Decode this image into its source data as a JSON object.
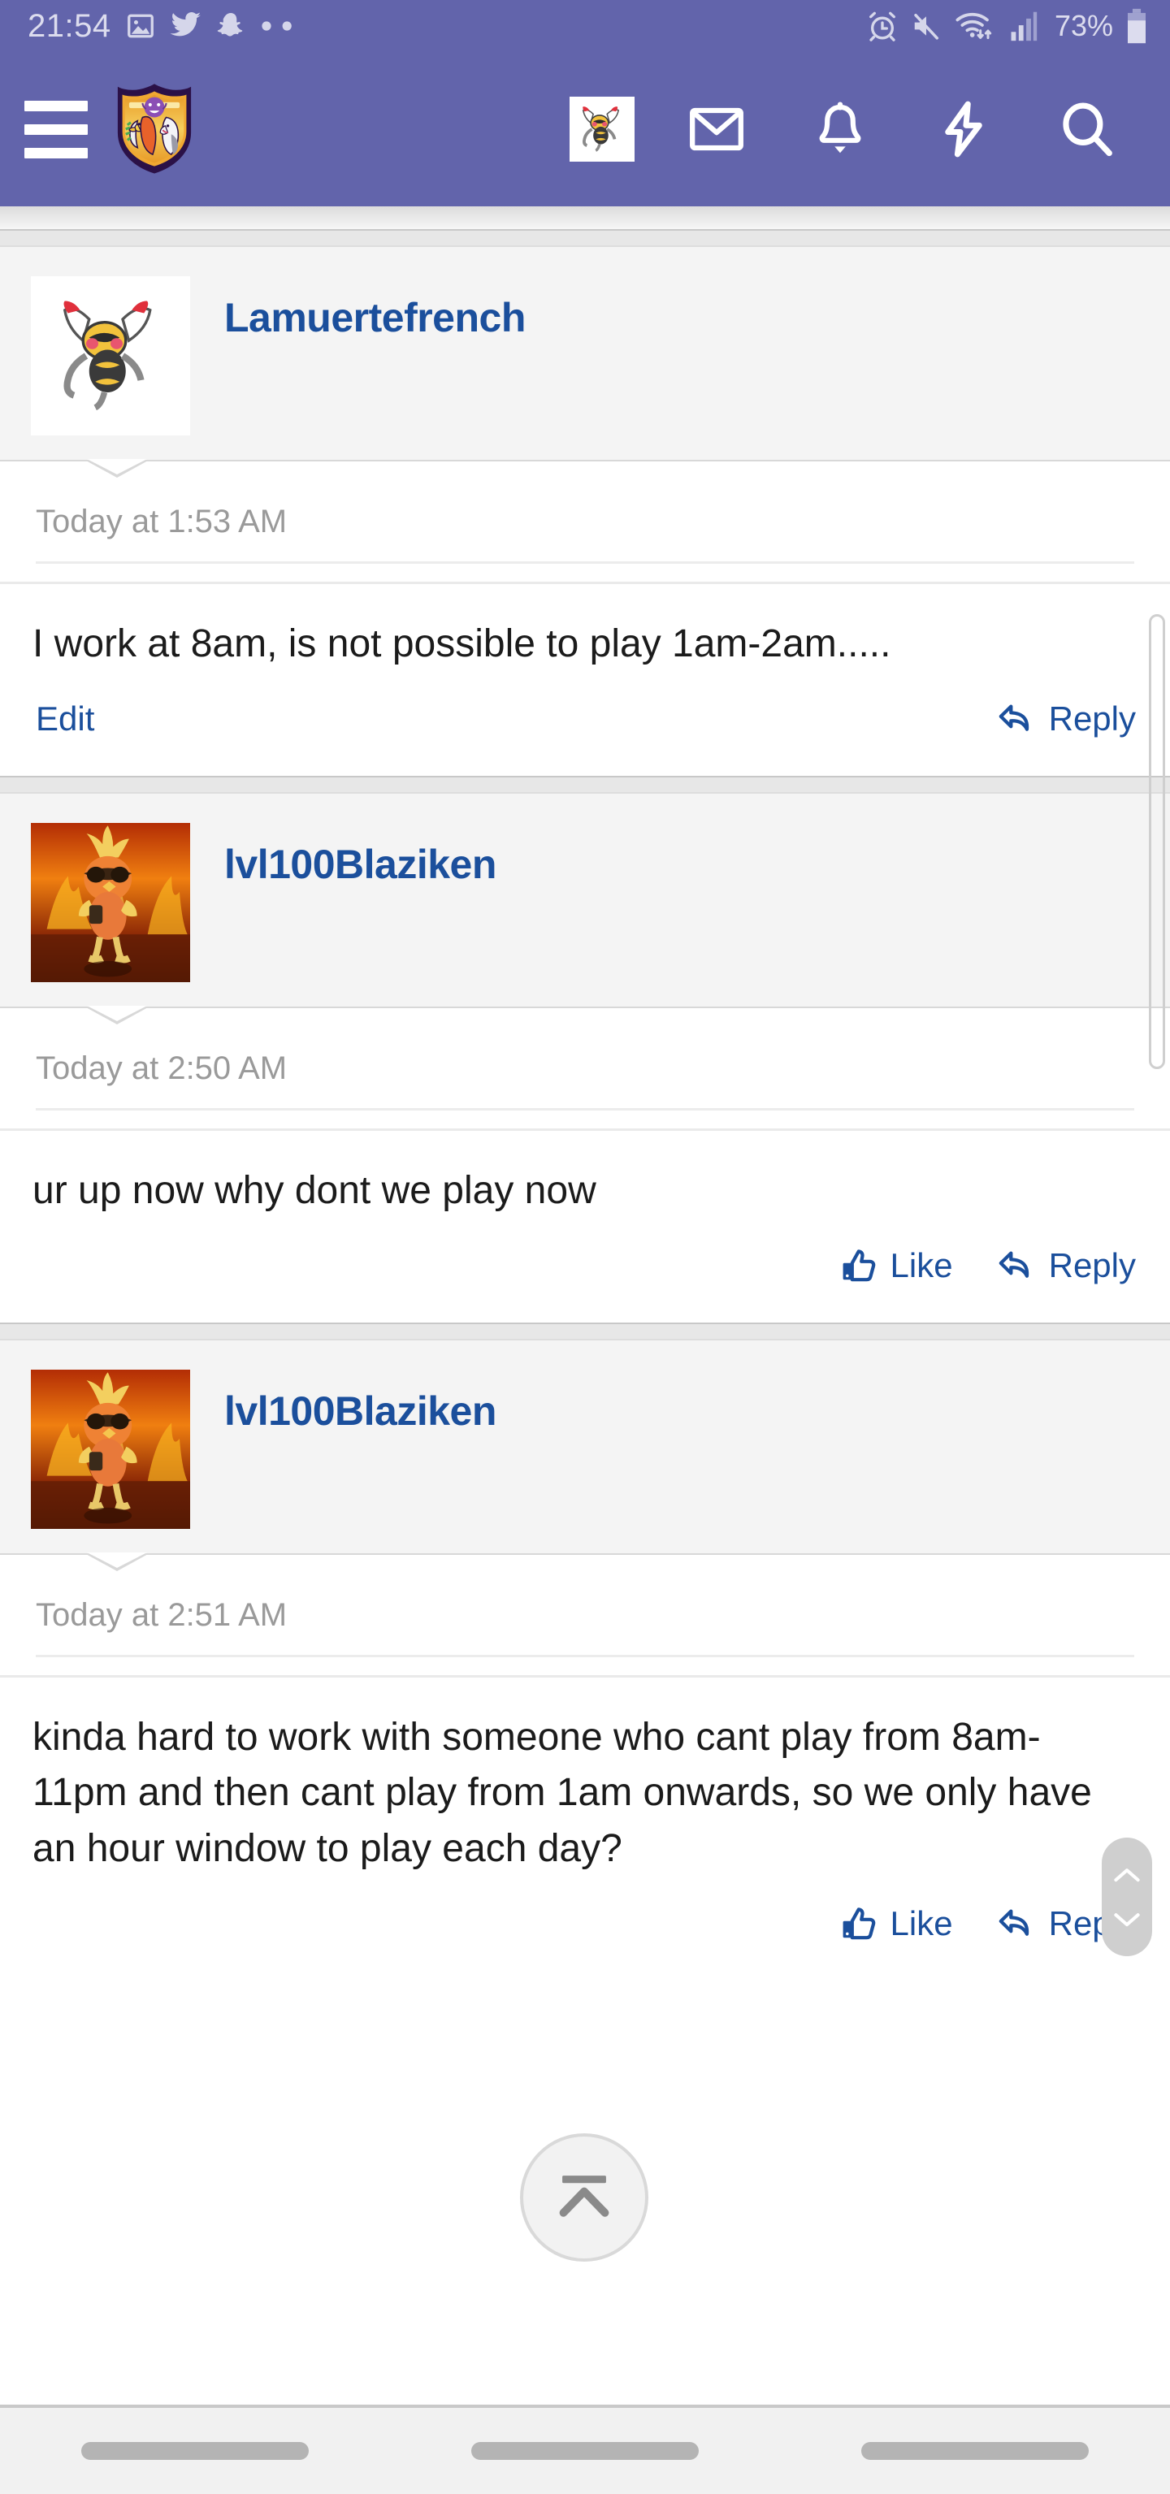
{
  "status_bar": {
    "time": "21:54",
    "battery_percent": "73%",
    "left_icons": [
      "photo-icon",
      "twitter-icon",
      "snapchat-icon",
      "more-dots-icon"
    ],
    "right_icons": [
      "alarm-icon",
      "mute-icon",
      "wifi-icon",
      "signal-icon",
      "battery-icon"
    ],
    "background": "#6264ab",
    "foreground": "#dcdcee"
  },
  "navbar": {
    "background": "#6264ab",
    "menu_icon": "hamburger-menu-icon",
    "logo": "forum-shield-logo",
    "items": [
      {
        "name": "account-avatar",
        "icon": "beedrill-avatar"
      },
      {
        "name": "inbox",
        "icon": "envelope-icon"
      },
      {
        "name": "alerts",
        "icon": "bell-icon"
      },
      {
        "name": "whats-new",
        "icon": "lightning-bolt-icon"
      },
      {
        "name": "search",
        "icon": "magnifier-icon"
      }
    ]
  },
  "thread": {
    "posts": [
      {
        "author": "Lamuertefrench",
        "avatar": "beedrill-sprite",
        "timestamp": "Today at 1:53 AM",
        "message": "I work at 8am, is not possible to play 1am-2am.....",
        "actions": [
          {
            "label": "Edit",
            "icon": null,
            "align": "left"
          },
          {
            "label": "Reply",
            "icon": "reply-arrow-icon",
            "align": "right"
          }
        ]
      },
      {
        "author": "lvl100Blaziken",
        "avatar": "torchic-fire-art",
        "timestamp": "Today at 2:50 AM",
        "message": "ur up now why dont we play now",
        "actions": [
          {
            "label": "Like",
            "icon": "thumbs-up-icon",
            "align": "right"
          },
          {
            "label": "Reply",
            "icon": "reply-arrow-icon",
            "align": "right"
          }
        ]
      },
      {
        "author": "lvl100Blaziken",
        "avatar": "torchic-fire-art",
        "timestamp": "Today at 2:51 AM",
        "message": "kinda hard to work with someone who cant play from 8am-11pm and then cant play from 1am onwards, so we only have an hour window to play each day?",
        "actions": [
          {
            "label": "Like",
            "icon": "thumbs-up-icon",
            "align": "right"
          },
          {
            "label": "Reply",
            "icon": "reply-arrow-icon",
            "align": "right"
          }
        ]
      }
    ],
    "link_color": "#1b4f9c",
    "timestamp_color": "#9a9a9a"
  },
  "floating": {
    "scroll_to_top": "scroll-to-top-icon",
    "scroll_nav_up": "chevron-up-icon",
    "scroll_nav_down": "chevron-down-icon"
  },
  "android_nav": {
    "buttons": [
      "recents-pill",
      "home-pill",
      "back-pill"
    ]
  }
}
